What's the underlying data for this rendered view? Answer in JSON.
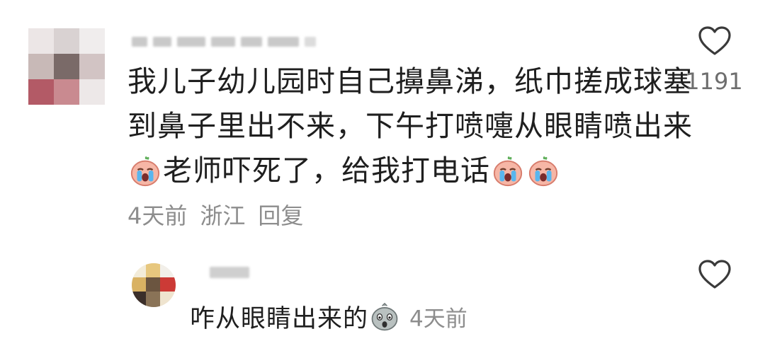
{
  "comment": {
    "like_count": "1191",
    "text_lines": [
      "我儿子幼儿园时自己擤鼻涕，纸巾搓成球塞",
      "到鼻子里出不来，下午打喷嚏从眼睛喷出来",
      "老师吓死了，给我打电话"
    ],
    "meta": {
      "time": "4天前",
      "location": "浙江",
      "reply_label": "回复"
    }
  },
  "reply": {
    "text": "咋从眼睛出来的",
    "time": "4天前"
  },
  "icons": {
    "heart": "heart-outline-icon",
    "crying_emoji": "loudly-crying-face-emoji",
    "shocked_emoji": "shocked-face-emoji"
  }
}
